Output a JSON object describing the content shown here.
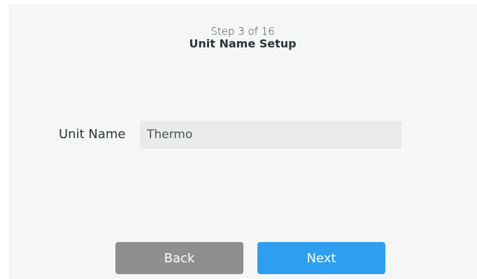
{
  "header": {
    "step": "Step 3 of 16",
    "title": "Unit Name Setup"
  },
  "form": {
    "unit_name_label": "Unit Name",
    "unit_name_value": "Thermo"
  },
  "actions": {
    "back_label": "Back",
    "next_label": "Next"
  },
  "colors": {
    "background": "#f5f6f6",
    "input_background": "#e9ebeb",
    "back_button": "#8f8f8f",
    "next_button": "#2e9ff0"
  }
}
